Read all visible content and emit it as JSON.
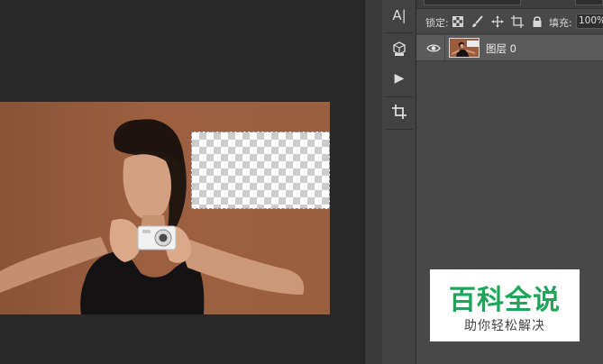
{
  "colors": {
    "app_background": "#282828",
    "panel_background": "#484848",
    "tool_column": "#424242",
    "selected_layer_row": "#5b5b5b",
    "photo_backdrop": "#9a5f3f",
    "watermark_green": "#1fa55a",
    "watermark_gray": "#444444"
  },
  "tool_column": {
    "items": [
      {
        "icon": "character-text-icon",
        "glyph": "A|"
      },
      {
        "icon": "3d-cube-icon"
      },
      {
        "icon": "play-actions-icon",
        "glyph": "▶"
      },
      {
        "icon": "crop-icon"
      }
    ]
  },
  "layers_panel": {
    "lock_label": "锁定:",
    "lock_icons": [
      "lock-transparent-pixels-icon",
      "lock-image-pixels-icon",
      "lock-position-icon",
      "lock-artboard-icon",
      "lock-all-icon"
    ],
    "fill_label": "填充:",
    "fill_value": "100%",
    "layers": [
      {
        "name": "图层 0",
        "visible": true,
        "selected": true
      }
    ]
  },
  "watermark": {
    "title": "百科全说",
    "subtitle": "助你轻松解决"
  }
}
